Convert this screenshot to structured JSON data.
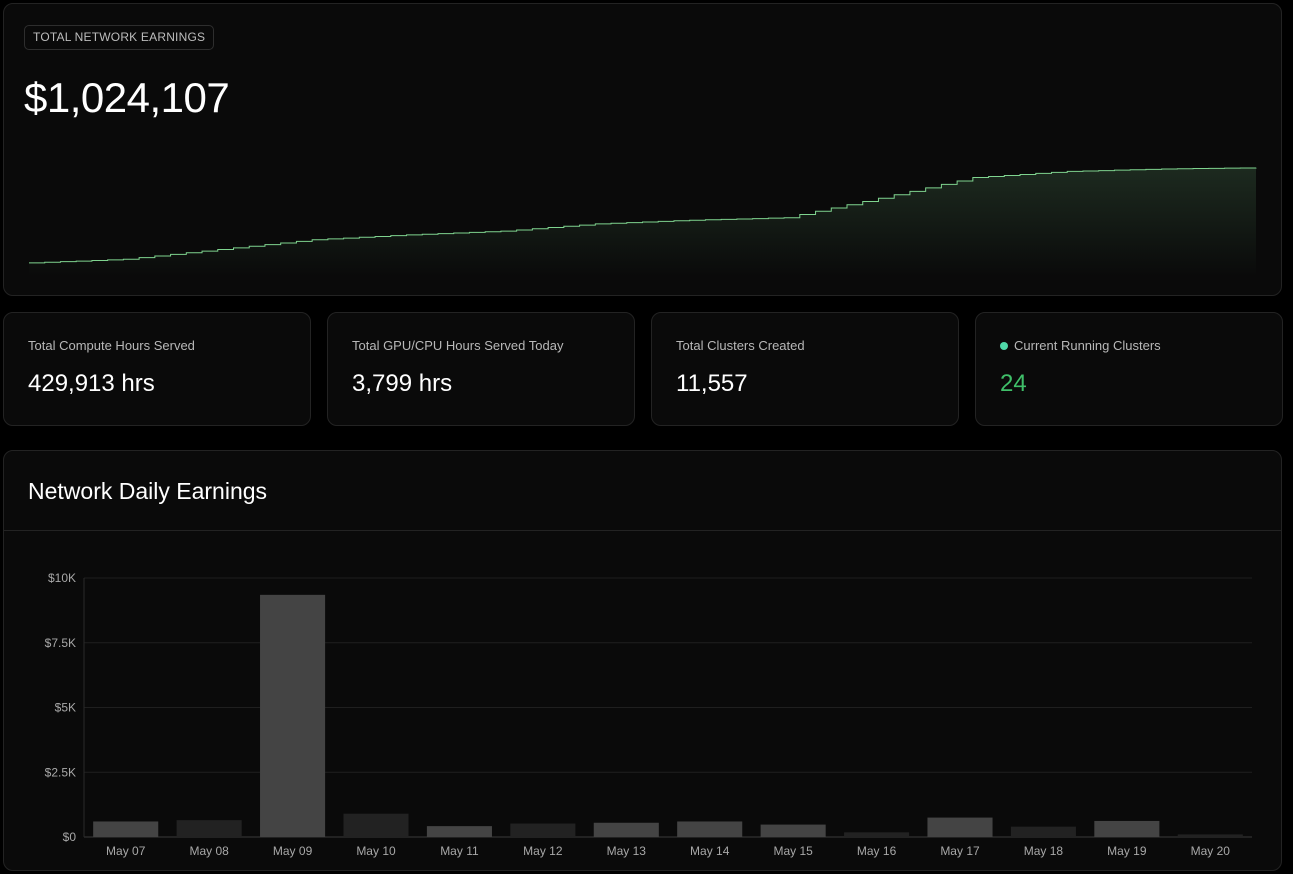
{
  "earnings": {
    "badge_label": "TOTAL NETWORK EARNINGS",
    "total_value": "$1,024,107",
    "line_color": "#7fd48f"
  },
  "stats": [
    {
      "label": "Total Compute Hours Served",
      "value": "429,913 hrs"
    },
    {
      "label": "Total GPU/CPU Hours Served Today",
      "value": "3,799 hrs"
    },
    {
      "label": "Total Clusters Created",
      "value": "11,557"
    },
    {
      "label": "Current Running Clusters",
      "value": "24",
      "status_color": "#4fd8a8",
      "value_color": "#3fbf69"
    }
  ],
  "daily": {
    "title": "Network Daily Earnings"
  },
  "chart_data": [
    {
      "type": "area",
      "title": "",
      "x": [
        "May 07",
        "May 08",
        "May 09",
        "May 10",
        "May 11",
        "May 12",
        "May 13",
        "May 14",
        "May 15",
        "May 16",
        "May 17",
        "May 18",
        "May 19",
        "May 20"
      ],
      "series": [
        {
          "values": [
            0.05,
            0.08,
            0.16,
            0.24,
            0.28,
            0.31,
            0.37,
            0.4,
            0.42,
            0.58,
            0.75,
            0.8,
            0.82,
            0.83
          ]
        }
      ],
      "grid": false,
      "legend": "none"
    },
    {
      "type": "bar",
      "title": "Network Daily Earnings",
      "categories": [
        "May 07",
        "May 08",
        "May 09",
        "May 10",
        "May 11",
        "May 12",
        "May 13",
        "May 14",
        "May 15",
        "May 16",
        "May 17",
        "May 18",
        "May 19",
        "May 20"
      ],
      "values": [
        600,
        650,
        9350,
        900,
        420,
        520,
        550,
        600,
        480,
        180,
        750,
        400,
        620,
        100
      ],
      "highlighted": [
        true,
        false,
        true,
        false,
        true,
        false,
        true,
        true,
        true,
        false,
        true,
        false,
        true,
        false
      ],
      "ylim": [
        0,
        10000
      ],
      "yticks": [
        {
          "value": 0,
          "label": "$0"
        },
        {
          "value": 2500,
          "label": "$2.5K"
        },
        {
          "value": 5000,
          "label": "$5K"
        },
        {
          "value": 7500,
          "label": "$7.5K"
        },
        {
          "value": 10000,
          "label": "$10K"
        }
      ],
      "bar_color": "#444444",
      "bar_color_dim": "#222222",
      "grid": true,
      "legend": "none"
    }
  ]
}
